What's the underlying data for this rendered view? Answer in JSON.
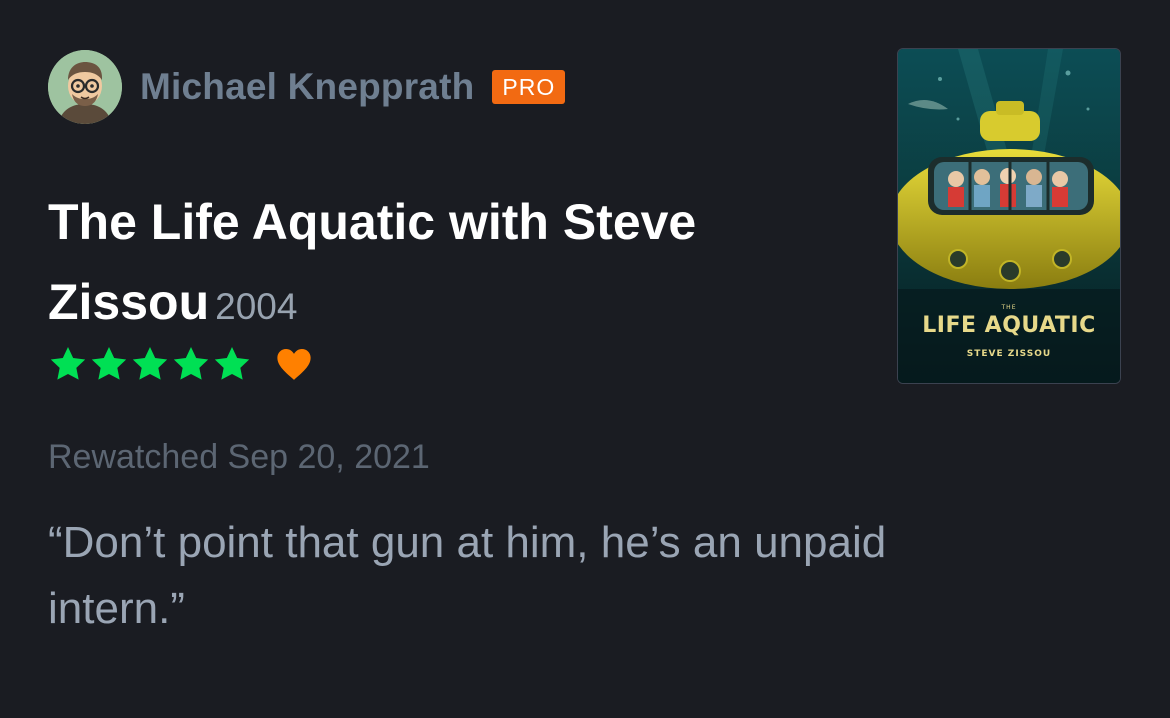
{
  "reviewer": {
    "name": "Michael Knepprath",
    "badge": "PRO"
  },
  "film": {
    "title": "The Life Aquatic with Steve Zissou",
    "year": "2004",
    "poster": {
      "small_top": "THE",
      "title": "LIFE AQUATIC",
      "subtitle": "STEVE ZISSOU"
    }
  },
  "rating": {
    "stars": 5,
    "max_stars": 5,
    "liked": true
  },
  "watched_label": "Rewatched Sep 20, 2021",
  "review_text": "“Don’t point that gun at him, he’s an unpaid intern.”",
  "colors": {
    "background": "#1a1c22",
    "star": "#00e054",
    "heart": "#ff8000",
    "pro_badge": "#f26a12"
  },
  "icons": {
    "avatar": "avatar-icon",
    "star": "star-icon",
    "heart": "heart-icon"
  }
}
